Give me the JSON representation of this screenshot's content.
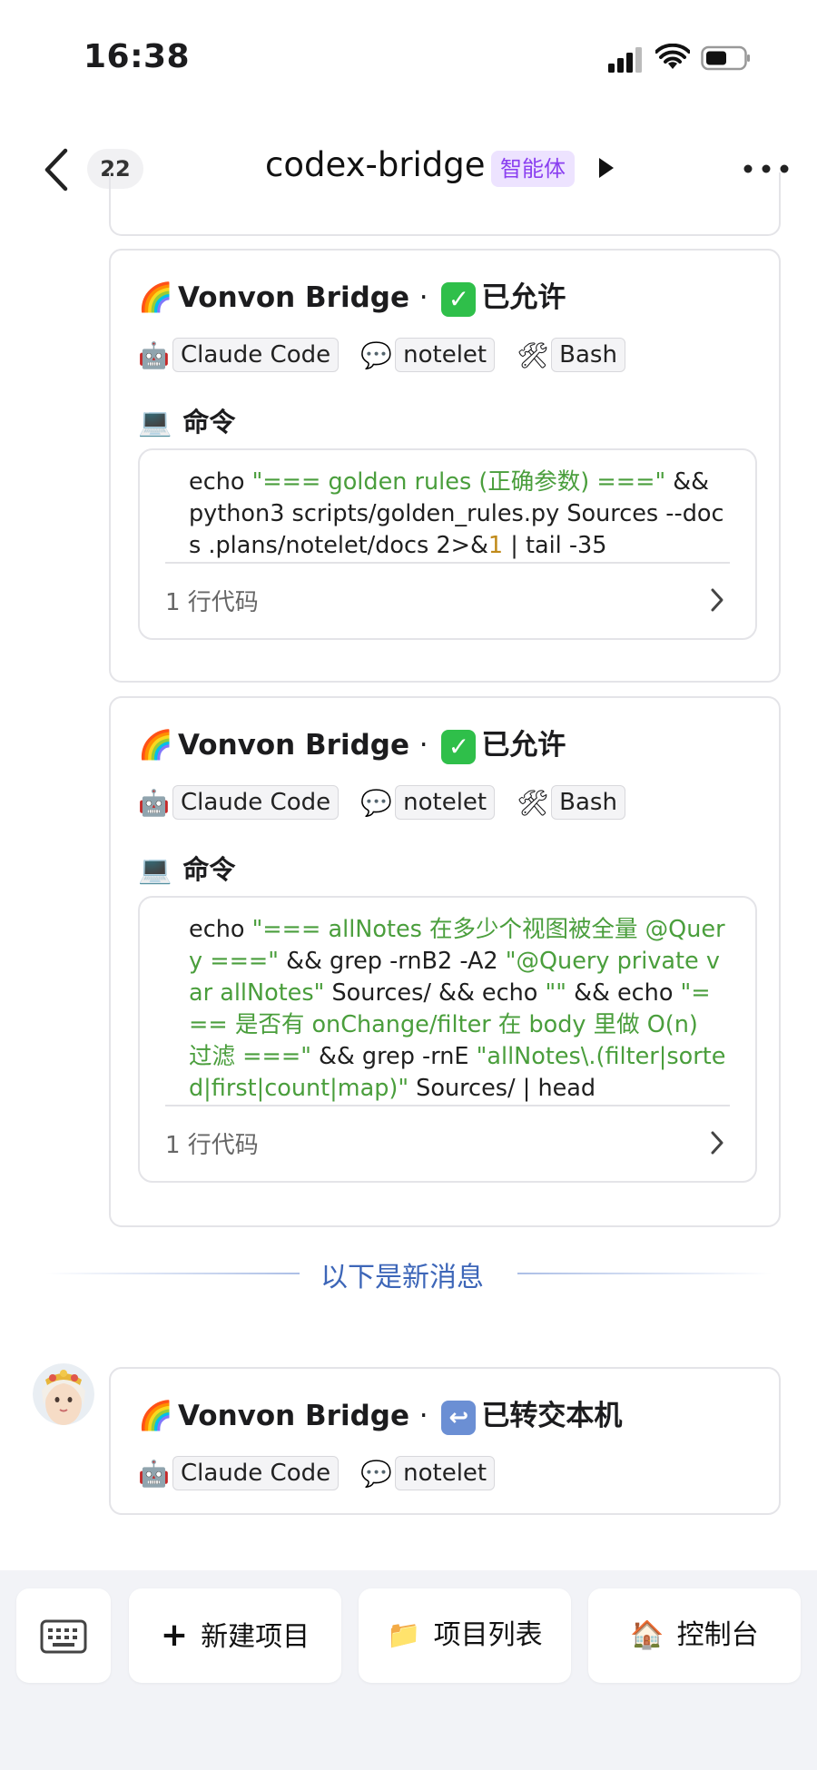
{
  "status_bar": {
    "time": "16:38"
  },
  "nav": {
    "back_count": "22",
    "title": "codex-bridge",
    "badge": "智能体"
  },
  "messages": [
    {
      "sender": "Vonvon Bridge",
      "sep": "·",
      "status": "已允许",
      "status_icon": "check-icon",
      "tags": [
        {
          "icon": "robot-icon",
          "label": "Claude Code"
        },
        {
          "icon": "speech-bubble-icon",
          "label": "notelet"
        },
        {
          "icon": "tools-icon",
          "label": "Bash"
        }
      ],
      "command_label": "命令",
      "code_parts": [
        {
          "t": "echo ",
          "k": "p"
        },
        {
          "t": "\"=== golden rules (正确参数) ===\"",
          "k": "s"
        },
        {
          "t": " && python3 scripts/golden_rules.py Sources --docs .plans/notelet/docs 2>&",
          "k": "p"
        },
        {
          "t": "1",
          "k": "n"
        },
        {
          "t": " | tail -35",
          "k": "p"
        }
      ],
      "line_count": "1 行代码"
    },
    {
      "sender": "Vonvon Bridge",
      "sep": "·",
      "status": "已允许",
      "status_icon": "check-icon",
      "tags": [
        {
          "icon": "robot-icon",
          "label": "Claude Code"
        },
        {
          "icon": "speech-bubble-icon",
          "label": "notelet"
        },
        {
          "icon": "tools-icon",
          "label": "Bash"
        }
      ],
      "command_label": "命令",
      "code_parts": [
        {
          "t": "echo ",
          "k": "p"
        },
        {
          "t": "\"=== allNotes 在多少个视图被全量 @Query ===\"",
          "k": "s"
        },
        {
          "t": " && grep -rnB2 -A2 ",
          "k": "p"
        },
        {
          "t": "\"@Query private var allNotes\"",
          "k": "s"
        },
        {
          "t": " Sources/ && echo ",
          "k": "p"
        },
        {
          "t": "\"\"",
          "k": "s"
        },
        {
          "t": " && echo ",
          "k": "p"
        },
        {
          "t": "\"=== 是否有 onChange/filter 在 body 里做 O(n) 过滤 ===\"",
          "k": "s"
        },
        {
          "t": " && grep -rnE ",
          "k": "p"
        },
        {
          "t": "\"allNotes\\.(filter|sorted|first|count|map)\"",
          "k": "s"
        },
        {
          "t": " Sources/ | head",
          "k": "p"
        }
      ],
      "line_count": "1 行代码"
    },
    {
      "sender": "Vonvon Bridge",
      "sep": "·",
      "status": "已转交本机",
      "status_icon": "return-arrow-icon",
      "tags": [
        {
          "icon": "robot-icon",
          "label": "Claude Code"
        },
        {
          "icon": "speech-bubble-icon",
          "label": "notelet"
        }
      ]
    }
  ],
  "divider_text": "以下是新消息",
  "bottom_bar": {
    "keyboard_icon": "keyboard-icon",
    "buttons": [
      {
        "icon": "plus-icon",
        "label": "新建项目"
      },
      {
        "icon": "folder-icon",
        "label": "项目列表"
      },
      {
        "icon": "house-icon",
        "label": "控制台"
      }
    ]
  },
  "colors": {
    "accent_badge": "#8a3ff0",
    "string": "#4a9e3c",
    "divider": "#3d66b8"
  }
}
